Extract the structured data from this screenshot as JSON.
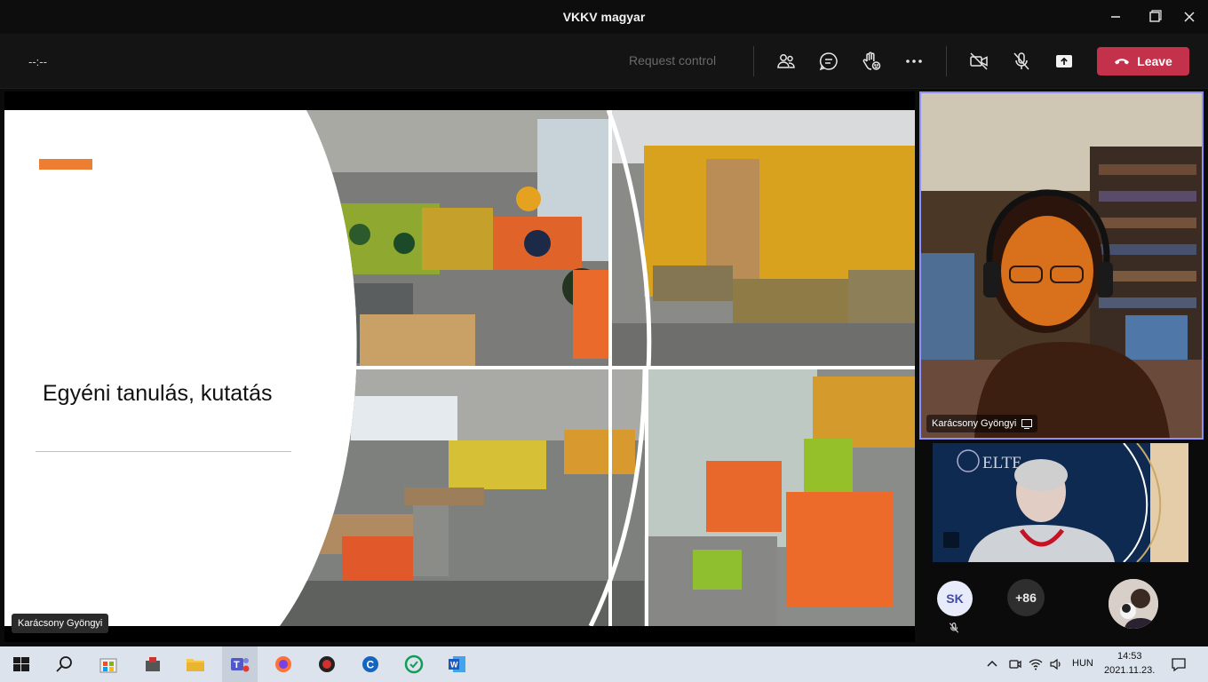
{
  "window": {
    "title": "VKKV magyar"
  },
  "toolbar": {
    "timer": "--:--",
    "request_control": "Request control",
    "leave_label": "Leave"
  },
  "slide": {
    "title": "Egyéni tanulás, kutatás"
  },
  "presenter": {
    "name": "Karácsony Gyöngyi"
  },
  "participants": {
    "speaker_tile_name": "Karácsony Gyöngyi",
    "avatar_initials": "SK",
    "more_count": "+86"
  },
  "taskbar": {
    "language": "HUN",
    "time": "14:53",
    "date": "2021.11.23."
  },
  "colors": {
    "leave": "#c4314b",
    "active_border": "#8e8ff5",
    "slide_accent": "#ed7d31"
  },
  "icons": [
    "close-icon",
    "maximize-icon",
    "minimize-icon",
    "people-icon",
    "chat-icon",
    "raise-hand-icon",
    "more-icon",
    "camera-off-icon",
    "mic-off-icon",
    "share-icon",
    "phone-icon",
    "windows-icon",
    "search-icon"
  ]
}
